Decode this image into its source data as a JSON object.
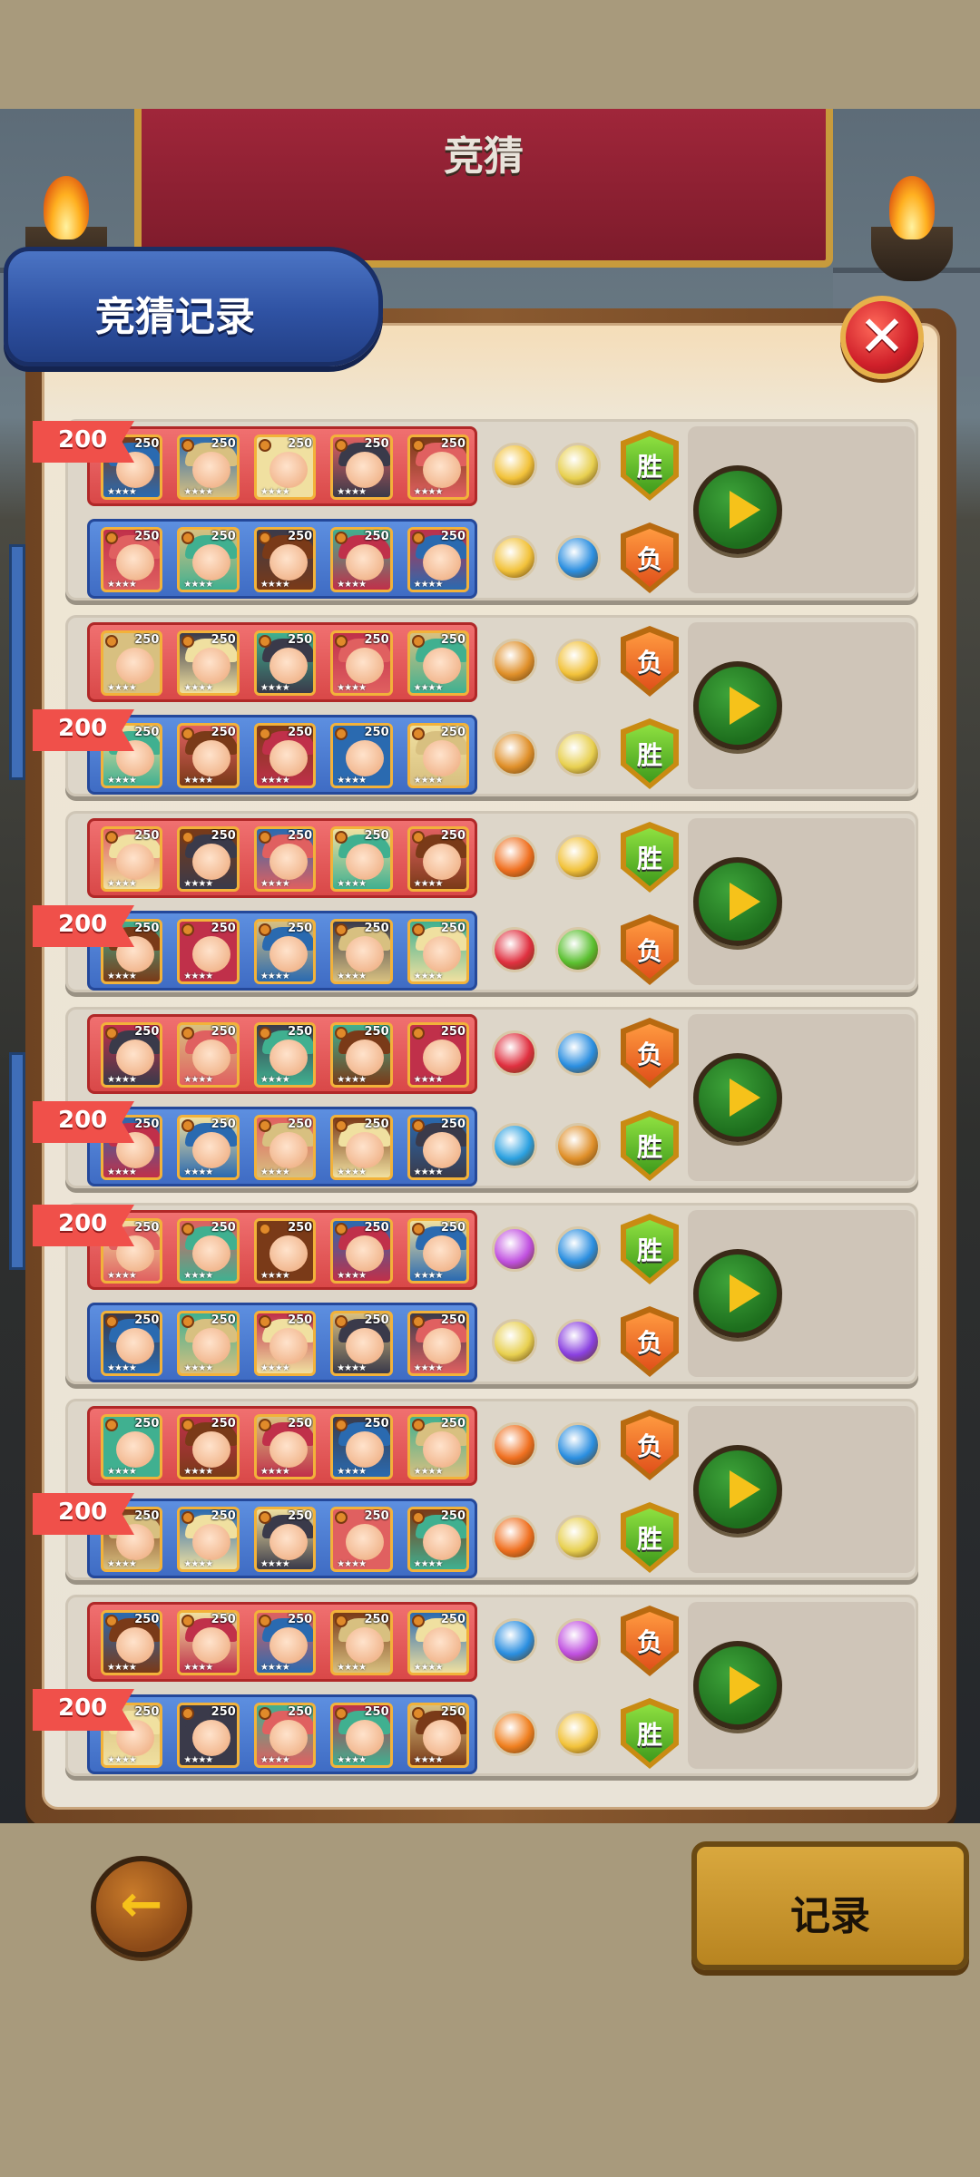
{
  "banner": {
    "title": "竞猜"
  },
  "header": {
    "title": "竞猜记录"
  },
  "close": {
    "icon": "close-icon",
    "glyph": "✕"
  },
  "colors": {
    "red_team": "#d94848",
    "blue_team": "#3f6cc4",
    "win": "#3f9a1c",
    "lose": "#e0501a",
    "bet_flag": "#f0504a"
  },
  "matches": [
    {
      "red": {
        "bet": "200",
        "result": "胜",
        "skills": [
          "#f2c23a",
          "#e8d050"
        ]
      },
      "blue": {
        "bet": "",
        "result": "负",
        "skills": [
          "#f2c23a",
          "#2a8ee0"
        ]
      }
    },
    {
      "red": {
        "bet": "",
        "result": "负",
        "skills": [
          "#e0902a",
          "#f2c23a"
        ]
      },
      "blue": {
        "bet": "200",
        "result": "胜",
        "skills": [
          "#e0902a",
          "#e8d050"
        ]
      }
    },
    {
      "red": {
        "bet": "",
        "result": "胜",
        "skills": [
          "#f07020",
          "#f2c23a"
        ]
      },
      "blue": {
        "bet": "200",
        "result": "负",
        "skills": [
          "#e03040",
          "#5ac030"
        ]
      }
    },
    {
      "red": {
        "bet": "",
        "result": "负",
        "skills": [
          "#e03040",
          "#2a8ee0"
        ]
      },
      "blue": {
        "bet": "200",
        "result": "胜",
        "skills": [
          "#2aa0e0",
          "#e0902a"
        ]
      }
    },
    {
      "red": {
        "bet": "200",
        "result": "胜",
        "skills": [
          "#c050e0",
          "#2a8ee0"
        ]
      },
      "blue": {
        "bet": "",
        "result": "负",
        "skills": [
          "#e8d050",
          "#8a40e0"
        ]
      }
    },
    {
      "red": {
        "bet": "",
        "result": "负",
        "skills": [
          "#f07020",
          "#2a8ee0"
        ]
      },
      "blue": {
        "bet": "200",
        "result": "胜",
        "skills": [
          "#f07020",
          "#e8d050"
        ]
      }
    },
    {
      "red": {
        "bet": "",
        "result": "负",
        "skills": [
          "#2a8ee0",
          "#c050e0"
        ]
      },
      "blue": {
        "bet": "200",
        "result": "胜",
        "skills": [
          "#f08020",
          "#f2c23a"
        ]
      }
    }
  ],
  "hero_level": "250",
  "hero_stars": "★★★★",
  "hero_palette": [
    "#7a3a18",
    "#c0304a",
    "#2a6ab0",
    "#d8c080",
    "#f0e0a0",
    "#3a3a4a",
    "#e06060",
    "#40b090"
  ],
  "footer": {
    "back_icon": "back-arrow-icon",
    "back_glyph": "←",
    "history_label": "记录"
  }
}
